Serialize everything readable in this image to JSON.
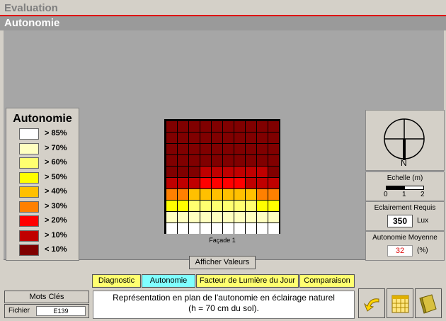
{
  "header": {
    "section": "Evaluation",
    "subsection": "Autonomie"
  },
  "legend": {
    "title": "Autonomie",
    "items": [
      {
        "label": "> 85%",
        "color": "#ffffff"
      },
      {
        "label": "> 70%",
        "color": "#ffffc0"
      },
      {
        "label": "> 60%",
        "color": "#ffff70"
      },
      {
        "label": "> 50%",
        "color": "#ffff00"
      },
      {
        "label": "> 40%",
        "color": "#ffc000"
      },
      {
        "label": "> 30%",
        "color": "#ff8000"
      },
      {
        "label": "> 20%",
        "color": "#ff0000"
      },
      {
        "label": "> 10%",
        "color": "#c00000"
      },
      {
        "label": "< 10%",
        "color": "#800000"
      }
    ]
  },
  "plan": {
    "facade_label": "Façade 1",
    "rows": [
      [
        8,
        8,
        8,
        8,
        8,
        8,
        8,
        8,
        8,
        8
      ],
      [
        8,
        8,
        8,
        8,
        8,
        8,
        8,
        8,
        8,
        8
      ],
      [
        8,
        8,
        8,
        8,
        8,
        8,
        8,
        8,
        8,
        8
      ],
      [
        8,
        8,
        8,
        8,
        8,
        8,
        8,
        8,
        8,
        8
      ],
      [
        8,
        8,
        8,
        7,
        7,
        7,
        7,
        7,
        7,
        8
      ],
      [
        7,
        7,
        7,
        6,
        6,
        6,
        6,
        7,
        7,
        7
      ],
      [
        5,
        5,
        4,
        4,
        4,
        4,
        4,
        4,
        5,
        5
      ],
      [
        3,
        3,
        2,
        2,
        2,
        2,
        2,
        2,
        3,
        3
      ],
      [
        1,
        1,
        1,
        1,
        1,
        1,
        1,
        1,
        1,
        1
      ],
      [
        0,
        0,
        0,
        0,
        0,
        0,
        0,
        0,
        0,
        0
      ]
    ]
  },
  "show_values_button": "Afficher Valeurs",
  "compass": {
    "north": "N"
  },
  "scale": {
    "title": "Echelle (m)",
    "ticks": [
      "0",
      "1",
      "2"
    ]
  },
  "illuminance": {
    "label": "Eclairement Requis",
    "value": "350",
    "unit": "Lux"
  },
  "autonomy_avg": {
    "label": "Autonomie Moyenne",
    "value": "32",
    "unit": "(%)"
  },
  "tabs": [
    {
      "label": "Diagnostic",
      "active": false
    },
    {
      "label": "Autonomie",
      "active": true
    },
    {
      "label": "Facteur de Lumière du Jour",
      "active": false
    },
    {
      "label": "Comparaison",
      "active": false
    }
  ],
  "mots_cles": "Mots Clés",
  "fichier": {
    "label": "Fichier",
    "value": "E139"
  },
  "description": {
    "line1": "Représentation en plan de l'autonomie en éclairage naturel",
    "line2": "(h = 70 cm du sol)."
  }
}
